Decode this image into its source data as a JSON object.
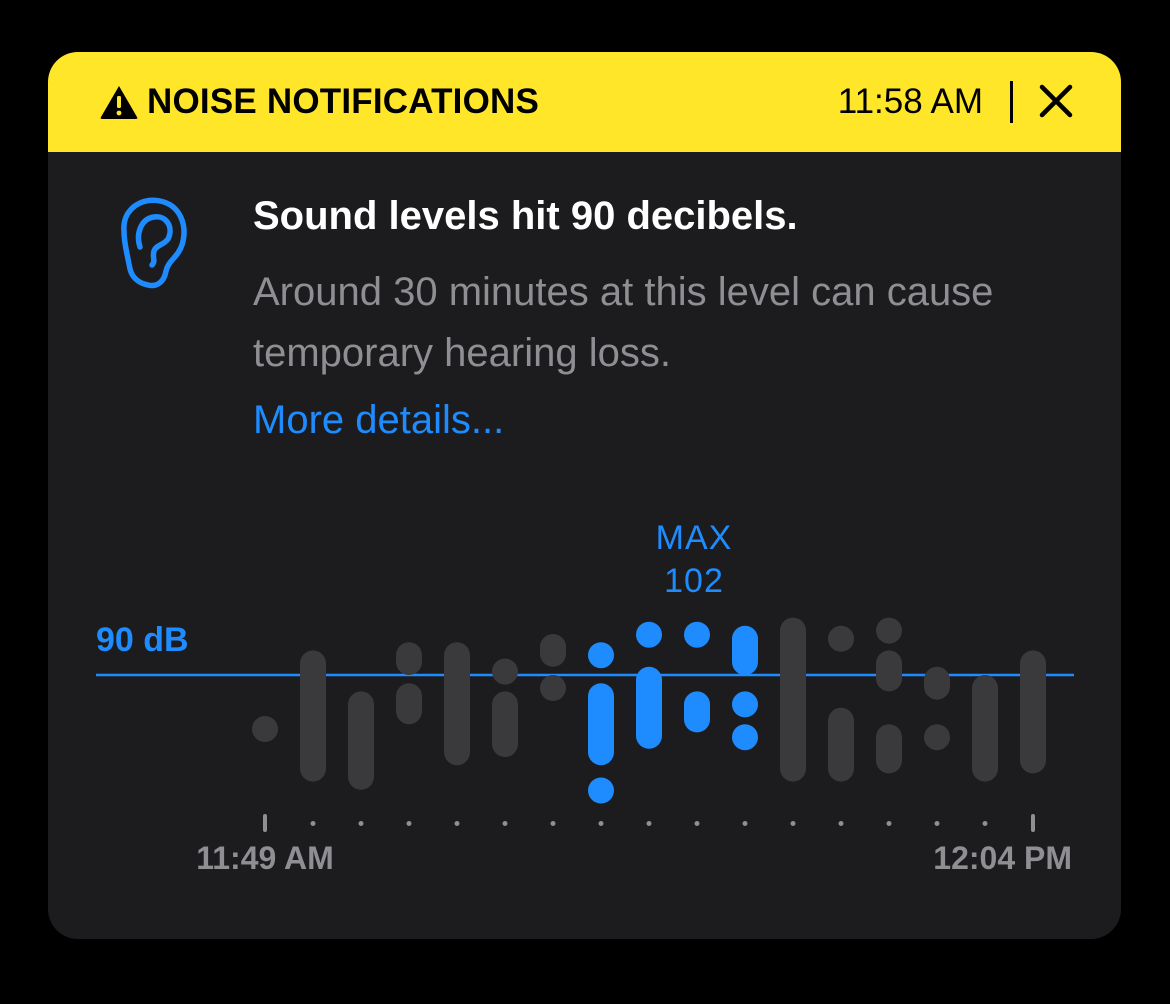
{
  "banner": {
    "title": "NOISE NOTIFICATIONS",
    "time": "11:58 AM",
    "warning_icon": "warning-triangle-icon",
    "close_icon": "close-icon",
    "background_color": "#ffe629"
  },
  "notification": {
    "icon": "ear-icon",
    "headline": "Sound levels hit 90 decibels.",
    "body": "Around 30 minutes at this level can cause temporary hearing loss.",
    "link": "More details..."
  },
  "colors": {
    "accent": "#1e8cff",
    "bar_inactive": "#3a3a3c",
    "secondary_text": "#8e8e93"
  },
  "chart_data": {
    "type": "bar",
    "threshold_label": "90 dB",
    "threshold": 90,
    "max_label": "MAX",
    "max_value": "102",
    "x_start_label": "11:49 AM",
    "x_end_label": "12:04 PM",
    "ylim": [
      74,
      108
    ],
    "highlight_color": "#1e8cff",
    "base_color": "#3a3a3c",
    "bars": [
      {
        "segments": [
          [
            82,
            85
          ]
        ],
        "highlight": false
      },
      {
        "segments": [
          [
            77,
            93
          ]
        ],
        "highlight": false
      },
      {
        "segments": [
          [
            76,
            88
          ]
        ],
        "highlight": false
      },
      {
        "segments": [
          [
            84,
            89
          ],
          [
            90,
            94
          ]
        ],
        "highlight": false
      },
      {
        "segments": [
          [
            79,
            94
          ]
        ],
        "highlight": false
      },
      {
        "segments": [
          [
            80,
            88
          ],
          [
            90,
            92
          ]
        ],
        "highlight": false
      },
      {
        "segments": [
          [
            87,
            90
          ],
          [
            91,
            95
          ]
        ],
        "highlight": false
      },
      {
        "segments": [
          [
            76.5,
            77.5
          ],
          [
            79,
            89
          ],
          [
            91,
            94
          ]
        ],
        "highlight": true
      },
      {
        "segments": [
          [
            81,
            91
          ],
          [
            95.5,
            96.5
          ]
        ],
        "highlight": true
      },
      {
        "segments": [
          [
            83,
            88
          ],
          [
            95.5,
            96.5
          ]
        ],
        "highlight": true
      },
      {
        "segments": [
          [
            82,
            84
          ],
          [
            86,
            88
          ],
          [
            90,
            96
          ]
        ],
        "highlight": true
      },
      {
        "segments": [
          [
            77,
            97
          ]
        ],
        "highlight": false
      },
      {
        "segments": [
          [
            77,
            86
          ],
          [
            94,
            96
          ]
        ],
        "highlight": false
      },
      {
        "segments": [
          [
            78,
            84
          ],
          [
            88,
            93
          ],
          [
            95,
            97
          ]
        ],
        "highlight": false
      },
      {
        "segments": [
          [
            81,
            84
          ],
          [
            87,
            91
          ]
        ],
        "highlight": false
      },
      {
        "segments": [
          [
            77,
            90
          ]
        ],
        "highlight": false
      },
      {
        "segments": [
          [
            78,
            93
          ]
        ],
        "highlight": false
      }
    ]
  }
}
